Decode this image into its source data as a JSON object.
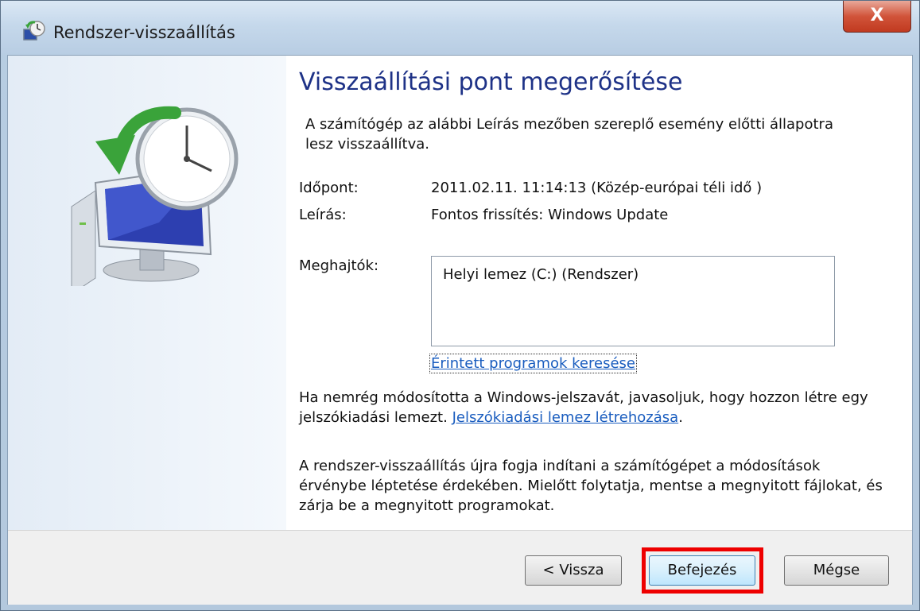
{
  "window": {
    "title": "Rendszer-visszaállítás",
    "close_label": "X"
  },
  "main": {
    "heading": "Visszaállítási pont megerősítése",
    "intro": "A számítógép az alábbi Leírás mezőben szereplő esemény előtti állapotra lesz visszaállítva.",
    "time_label": "Időpont:",
    "time_value": "2011.02.11. 11:14:13 (Közép-európai téli idő )",
    "desc_label": "Leírás:",
    "desc_value": "Fontos frissítés: Windows Update",
    "drives_label": "Meghajtók:",
    "drives": [
      "Helyi lemez (C:) (Rendszer)"
    ],
    "affected_link": "Érintett programok keresése",
    "password_text": "Ha nemrég módosította a Windows-jelszavát, javasoljuk, hogy hozzon létre egy jelszókiadási lemezt.",
    "password_link": "Jelszókiadási lemez létrehozása",
    "password_suffix": ".",
    "restart_text": "A rendszer-visszaállítás újra fogja indítani a számítógépet a módosítások érvénybe léptetése érdekében. Mielőtt folytatja, mentse a megnyitott fájlokat, és zárja be a megnyitott programokat."
  },
  "footer": {
    "back_label": "< Vissza",
    "finish_label": "Befejezés",
    "cancel_label": "Mégse"
  },
  "colors": {
    "heading": "#1e3287",
    "link": "#1a5dbf",
    "highlight": "#ee0000"
  }
}
